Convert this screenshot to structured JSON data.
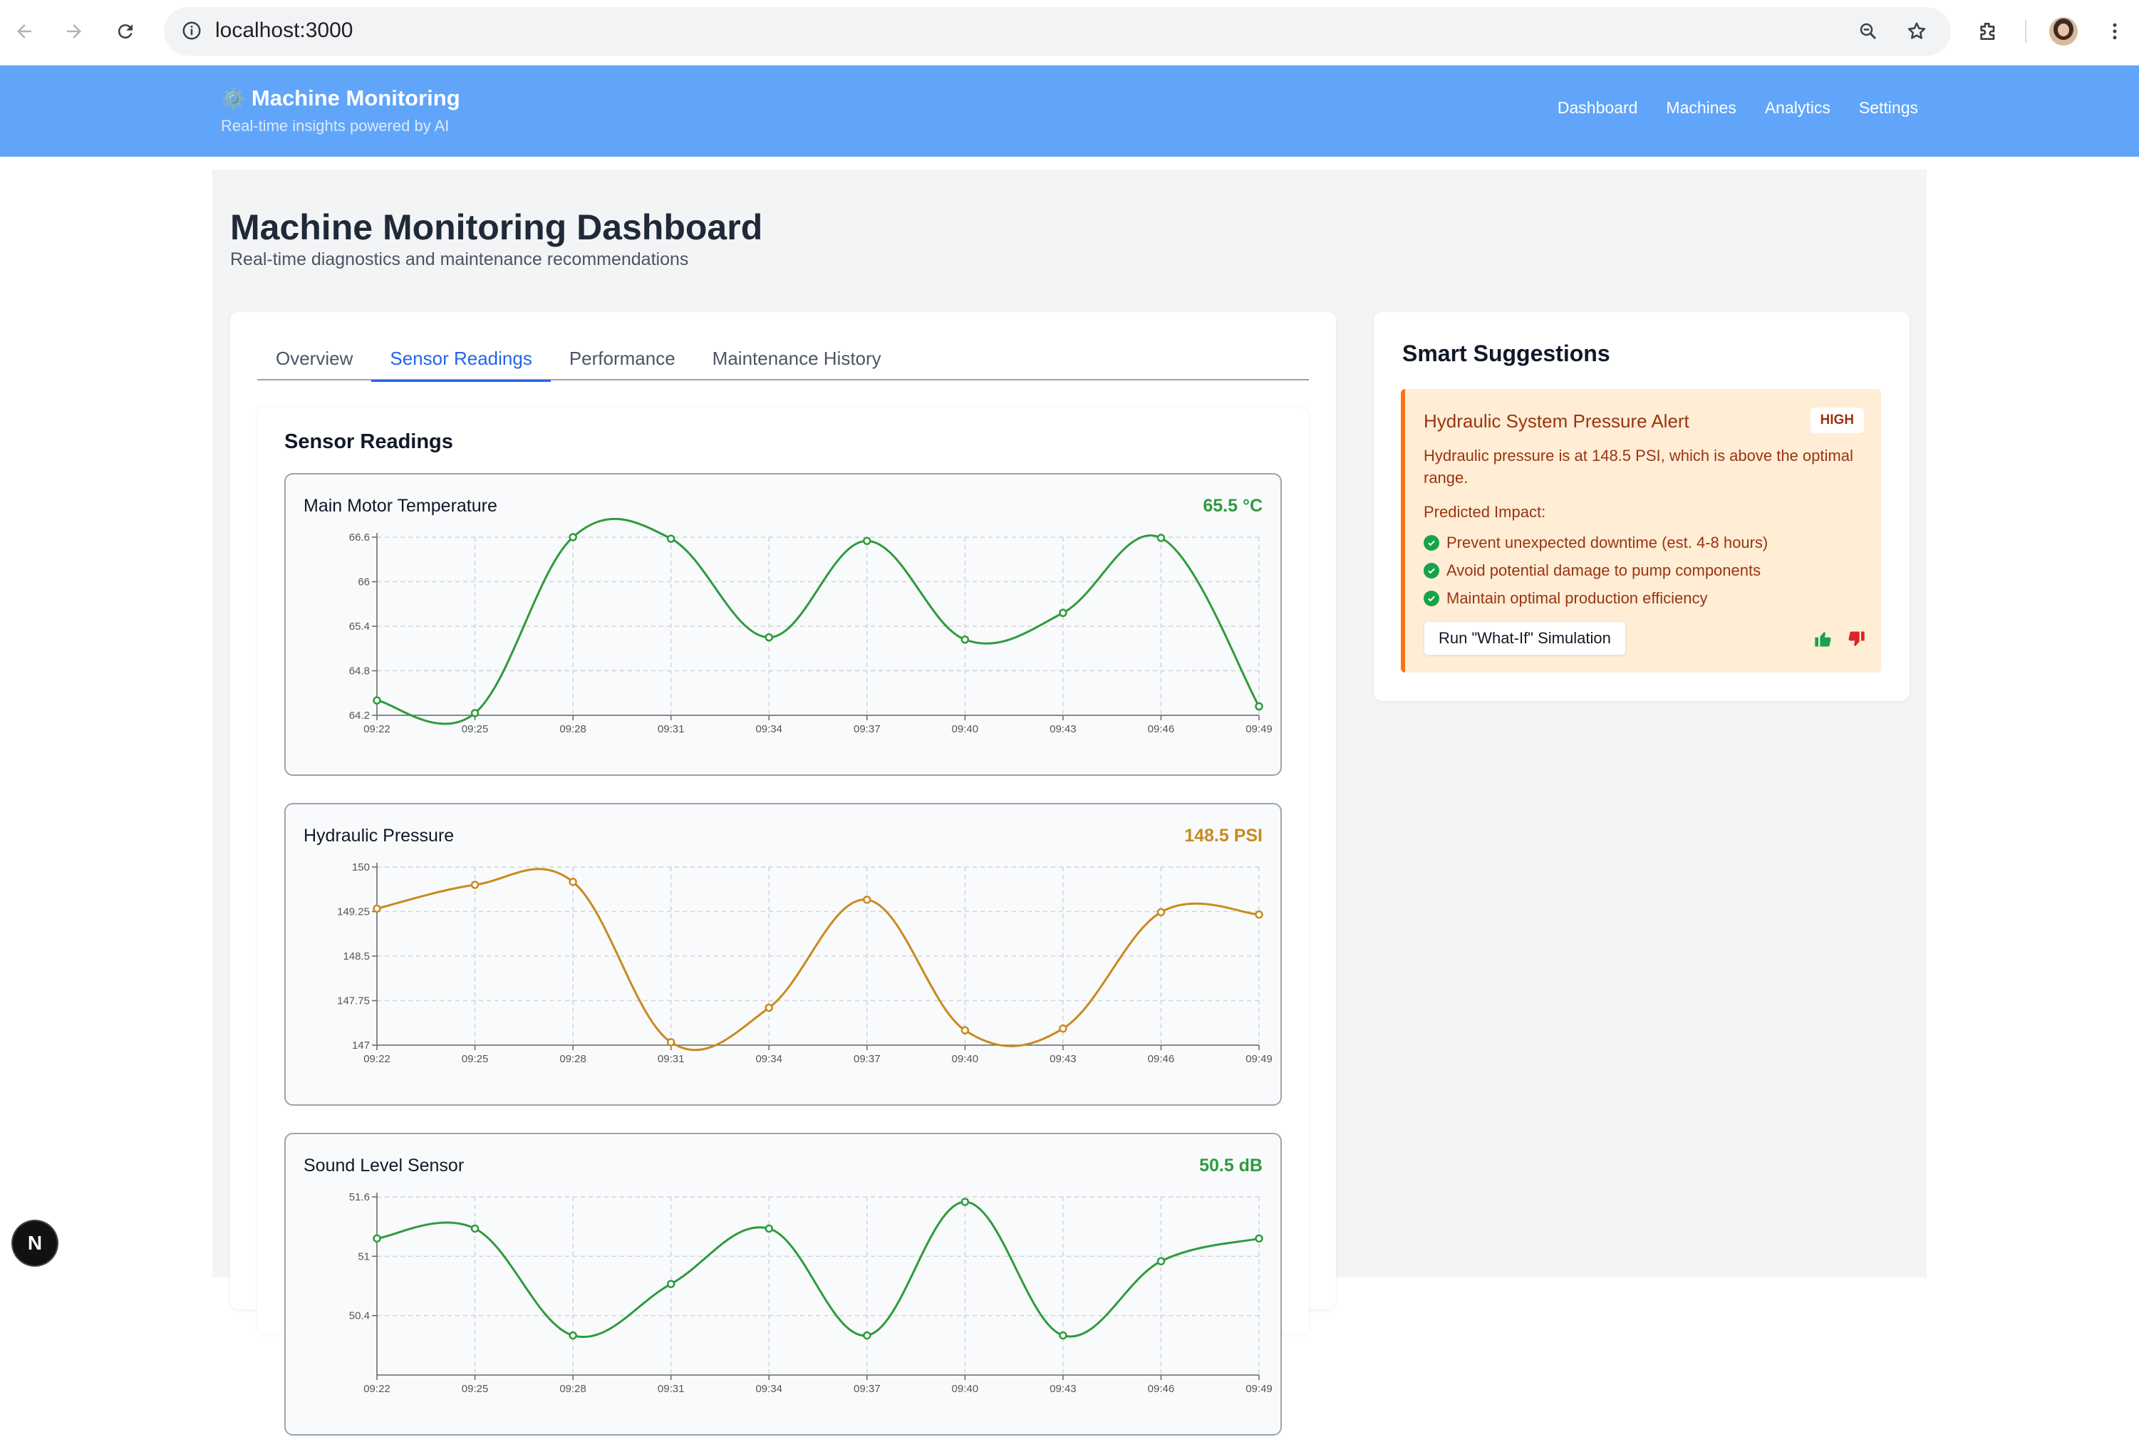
{
  "browser": {
    "url": "localhost:3000"
  },
  "header": {
    "brand_icon": "⚙️",
    "brand": "Machine Monitoring",
    "tagline": "Real-time insights powered by AI",
    "nav": [
      "Dashboard",
      "Machines",
      "Analytics",
      "Settings"
    ]
  },
  "page": {
    "title": "Machine Monitoring Dashboard",
    "subtitle": "Real-time diagnostics and maintenance recommendations"
  },
  "tabs": {
    "items": [
      "Overview",
      "Sensor Readings",
      "Performance",
      "Maintenance History"
    ],
    "active": "Sensor Readings"
  },
  "readings": {
    "title": "Sensor Readings"
  },
  "chart_data": [
    {
      "type": "line",
      "title": "Main Motor Temperature",
      "current_value": "65.5 °C",
      "color": "#2e9b3e",
      "x": [
        "09:22",
        "09:25",
        "09:28",
        "09:31",
        "09:34",
        "09:37",
        "09:40",
        "09:43",
        "09:46",
        "09:49"
      ],
      "y": [
        64.4,
        64.23,
        66.6,
        66.58,
        65.25,
        66.55,
        65.22,
        65.58,
        66.59,
        64.32
      ],
      "yticks": [
        "64.2",
        "64.8",
        "65.4",
        "66",
        "66.6"
      ],
      "ylim": [
        64.2,
        66.6
      ],
      "grid": true
    },
    {
      "type": "line",
      "title": "Hydraulic Pressure",
      "current_value": "148.5 PSI",
      "color": "#c98a1e",
      "x": [
        "09:22",
        "09:25",
        "09:28",
        "09:31",
        "09:34",
        "09:37",
        "09:40",
        "09:43",
        "09:46",
        "09:49"
      ],
      "y": [
        149.3,
        149.7,
        149.75,
        147.05,
        147.63,
        149.45,
        147.25,
        147.28,
        149.24,
        149.2
      ],
      "yticks": [
        "147",
        "147.75",
        "148.5",
        "149.25",
        "150"
      ],
      "ylim": [
        147,
        150
      ],
      "grid": true
    },
    {
      "type": "line",
      "title": "Sound Level Sensor",
      "current_value": "50.5 dB",
      "color": "#2e9b3e",
      "x": [
        "09:22",
        "09:25",
        "09:28",
        "09:31",
        "09:34",
        "09:37",
        "09:40",
        "09:43",
        "09:46",
        "09:49"
      ],
      "y": [
        51.18,
        51.28,
        50.2,
        50.72,
        51.28,
        50.2,
        51.55,
        50.2,
        50.95,
        51.18
      ],
      "yticks": [
        "50.4",
        "51",
        "51.6"
      ],
      "ylim": [
        49.8,
        51.6
      ],
      "grid": true
    }
  ],
  "suggestions": {
    "title": "Smart Suggestions",
    "alert": {
      "title": "Hydraulic System Pressure Alert",
      "severity": "HIGH",
      "description": "Hydraulic pressure is at 148.5 PSI, which is above the optimal range.",
      "impact_label": "Predicted Impact:",
      "impacts": [
        "Prevent unexpected downtime (est. 4-8 hours)",
        "Avoid potential damage to pump components",
        "Maintain optimal production efficiency"
      ],
      "action": "Run \"What-If\" Simulation"
    }
  },
  "dev_badge": "N"
}
